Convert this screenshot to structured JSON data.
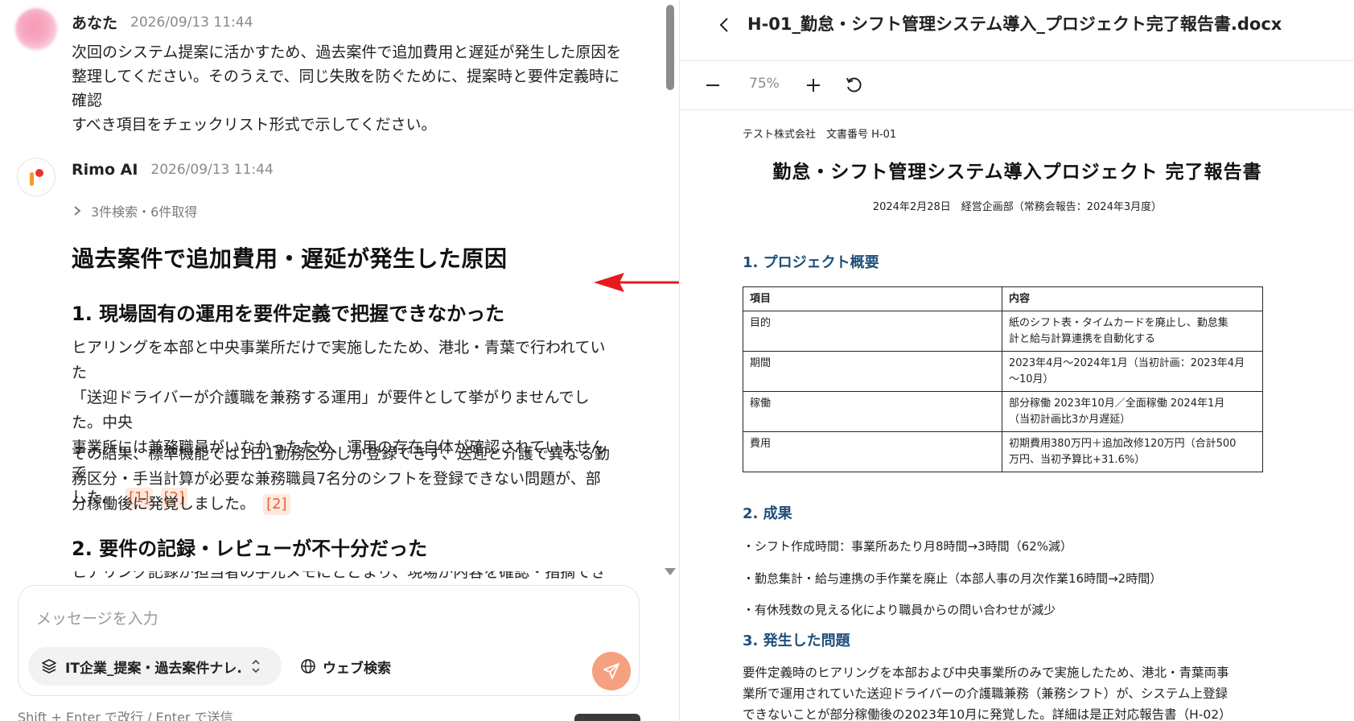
{
  "chat": {
    "user_message": {
      "author": "あなた",
      "time": "2026/09/13 11:44",
      "lines": [
        "次回のシステム提案に活かすため、過去案件で追加費用と遅延が発生した原因を",
        "整理してください。そのうえで、同じ失敗を防ぐために、提案時と要件定義時に確認",
        "すべき項目をチェックリスト形式で示してください。"
      ]
    },
    "ai_message": {
      "author": "Rimo AI",
      "time": "2026/09/13 11:44",
      "tool_summary": "3件検索・6件取得",
      "heading": "過去案件で追加費用・遅延が発生した原因",
      "section1_heading": "1. 現場固有の運用を要件定義で把握できなかった",
      "section1_para1_lines": [
        "ヒアリングを本部と中央事業所だけで実施したため、港北・青葉で行われていた",
        "「送迎ドライバーが介護職を兼務する運用」が要件として挙がりませんでした。中央",
        "事業所には兼務職員がいなかったため、運用の存在自体が確認されていませんで",
        "した。"
      ],
      "cite_1": "[1]",
      "cite_2": "[2]",
      "section1_para2_lines": [
        "その結果、標準機能では1日1勤務区分しか登録できず、送迎と介護で異なる勤",
        "務区分・手当計算が必要な兼務職員7名分のシフトを登録できない問題が、部",
        "分稼働後に発覚しました。"
      ],
      "cite_3": "[2]",
      "section2_heading": "2. 要件の記録・レビューが不十分だった",
      "section2_para_partial": "ヒアリング記録が担当者の手元メモにとどまり、現場が内容を確認・指摘できる状"
    },
    "input": {
      "placeholder": "メッセージを入力",
      "knowledge_base": "IT企業_提案・過去案件ナレ...",
      "web_search": "ウェブ検索",
      "hint": "Shift + Enter で改行 / Enter で送信"
    }
  },
  "doc": {
    "filename": "H-01_勤怠・シフト管理システム導入_プロジェクト完了報告書.docx",
    "zoom": "75%",
    "meta": "テスト株式会社　文書番号 H-01",
    "title": "勤怠・シフト管理システム導入プロジェクト 完了報告書",
    "date_line": "2024年2月28日　経営企画部（常務会報告：2024年3月度）",
    "section1_heading": "1. プロジェクト概要",
    "table": {
      "headers": [
        "項目",
        "内容"
      ],
      "rows": [
        {
          "item": "目的",
          "content_lines": [
            "紙のシフト表・タイムカードを廃止し、勤怠集",
            "計と給与計算連携を自動化する"
          ]
        },
        {
          "item": "期間",
          "content_lines": [
            "2023年4月～2024年1月（当初計画：2023年4月",
            "～10月）"
          ]
        },
        {
          "item": "稼働",
          "content_lines": [
            "部分稼働 2023年10月／全面稼働 2024年1月",
            "（当初計画比3か月遅延）"
          ]
        },
        {
          "item": "費用",
          "content_lines": [
            "初期費用380万円＋追加改修120万円（合計500",
            "万円、当初予算比+31.6%）"
          ]
        }
      ]
    },
    "section2_heading": "2. 成果",
    "results": [
      "・シフト作成時間：事業所あたり月8時間→3時間（62%減）",
      "・勤怠集計・給与連携の手作業を廃止（本部人事の月次作業16時間→2時間）",
      "・有休残数の見える化により職員からの問い合わせが減少"
    ],
    "section3_heading": "3. 発生した問題",
    "problem_lines": [
      "要件定義時のヒアリングを本部および中央事業所のみで実施したため、港北・青葉両事",
      "業所で運用されていた送迎ドライバーの介護職兼務（兼務シフト）が、システム上登録",
      "できないことが部分稼働後の2023年10月に発覚した。詳細は是正対応報告書（H-02）"
    ]
  },
  "colors": {
    "accent_orange": "#e8632a",
    "send_button": "#f5a07e",
    "doc_heading_blue": "#1f4e79",
    "arrow_red": "#e8191b"
  }
}
